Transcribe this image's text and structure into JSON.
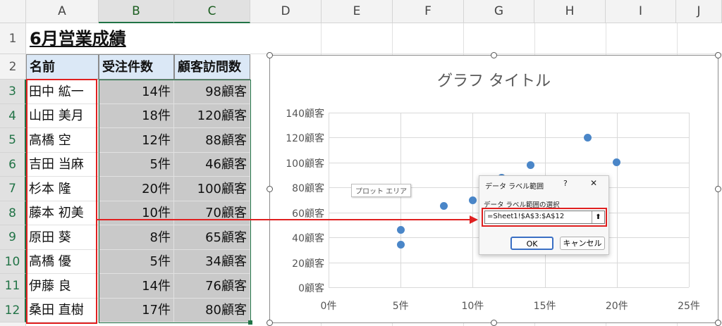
{
  "columns": [
    "A",
    "B",
    "C",
    "D",
    "E",
    "F",
    "G",
    "H",
    "I",
    "J"
  ],
  "rows": [
    "1",
    "2",
    "3",
    "4",
    "5",
    "6",
    "7",
    "8",
    "9",
    "10",
    "11",
    "12"
  ],
  "sheet_title": "6月営業成績",
  "headers": [
    "名前",
    "受注件数",
    "顧客訪問数"
  ],
  "table": [
    [
      "田中 絋一",
      "14件",
      "98顧客"
    ],
    [
      "山田 美月",
      "18件",
      "120顧客"
    ],
    [
      "高橋 空",
      "12件",
      "88顧客"
    ],
    [
      "吉田 当麻",
      "5件",
      "46顧客"
    ],
    [
      "杉本 隆",
      "20件",
      "100顧客"
    ],
    [
      "藤本 初美",
      "10件",
      "70顧客"
    ],
    [
      "原田 葵",
      "8件",
      "65顧客"
    ],
    [
      "高橋 優",
      "5件",
      "34顧客"
    ],
    [
      "伊藤 良",
      "14件",
      "76顧客"
    ],
    [
      "桑田 直樹",
      "17件",
      "80顧客"
    ]
  ],
  "chart": {
    "title": "グラフ タイトル",
    "plot_area_tooltip": "プロット エリア"
  },
  "chart_data": {
    "type": "scatter",
    "title": "グラフ タイトル",
    "x_ticks": [
      "0件",
      "5件",
      "10件",
      "15件",
      "20件",
      "25件"
    ],
    "y_ticks": [
      "0顧客",
      "20顧客",
      "40顧客",
      "60顧客",
      "80顧客",
      "100顧客",
      "120顧客",
      "140顧客"
    ],
    "xlim": [
      0,
      25
    ],
    "ylim": [
      0,
      140
    ],
    "grid": true,
    "points": [
      {
        "x": 14,
        "y": 98
      },
      {
        "x": 18,
        "y": 120
      },
      {
        "x": 12,
        "y": 88
      },
      {
        "x": 5,
        "y": 46
      },
      {
        "x": 20,
        "y": 100
      },
      {
        "x": 10,
        "y": 70
      },
      {
        "x": 8,
        "y": 65
      },
      {
        "x": 5,
        "y": 34
      },
      {
        "x": 14,
        "y": 76
      },
      {
        "x": 17,
        "y": 80
      }
    ],
    "color": "#4a86c8"
  },
  "dialog": {
    "title": "データ ラベル範囲",
    "help": "?",
    "close": "✕",
    "label": "データ ラベル範囲の選択",
    "value": "=Sheet1!$A$3:$A$12",
    "collapse_icon": "⬆",
    "ok": "OK",
    "cancel": "キャンセル"
  },
  "colors": {
    "accent_red": "#e02020",
    "excel_green": "#217346",
    "header_fill": "#dbe8f6",
    "gray_fill": "#c9c9c9"
  }
}
